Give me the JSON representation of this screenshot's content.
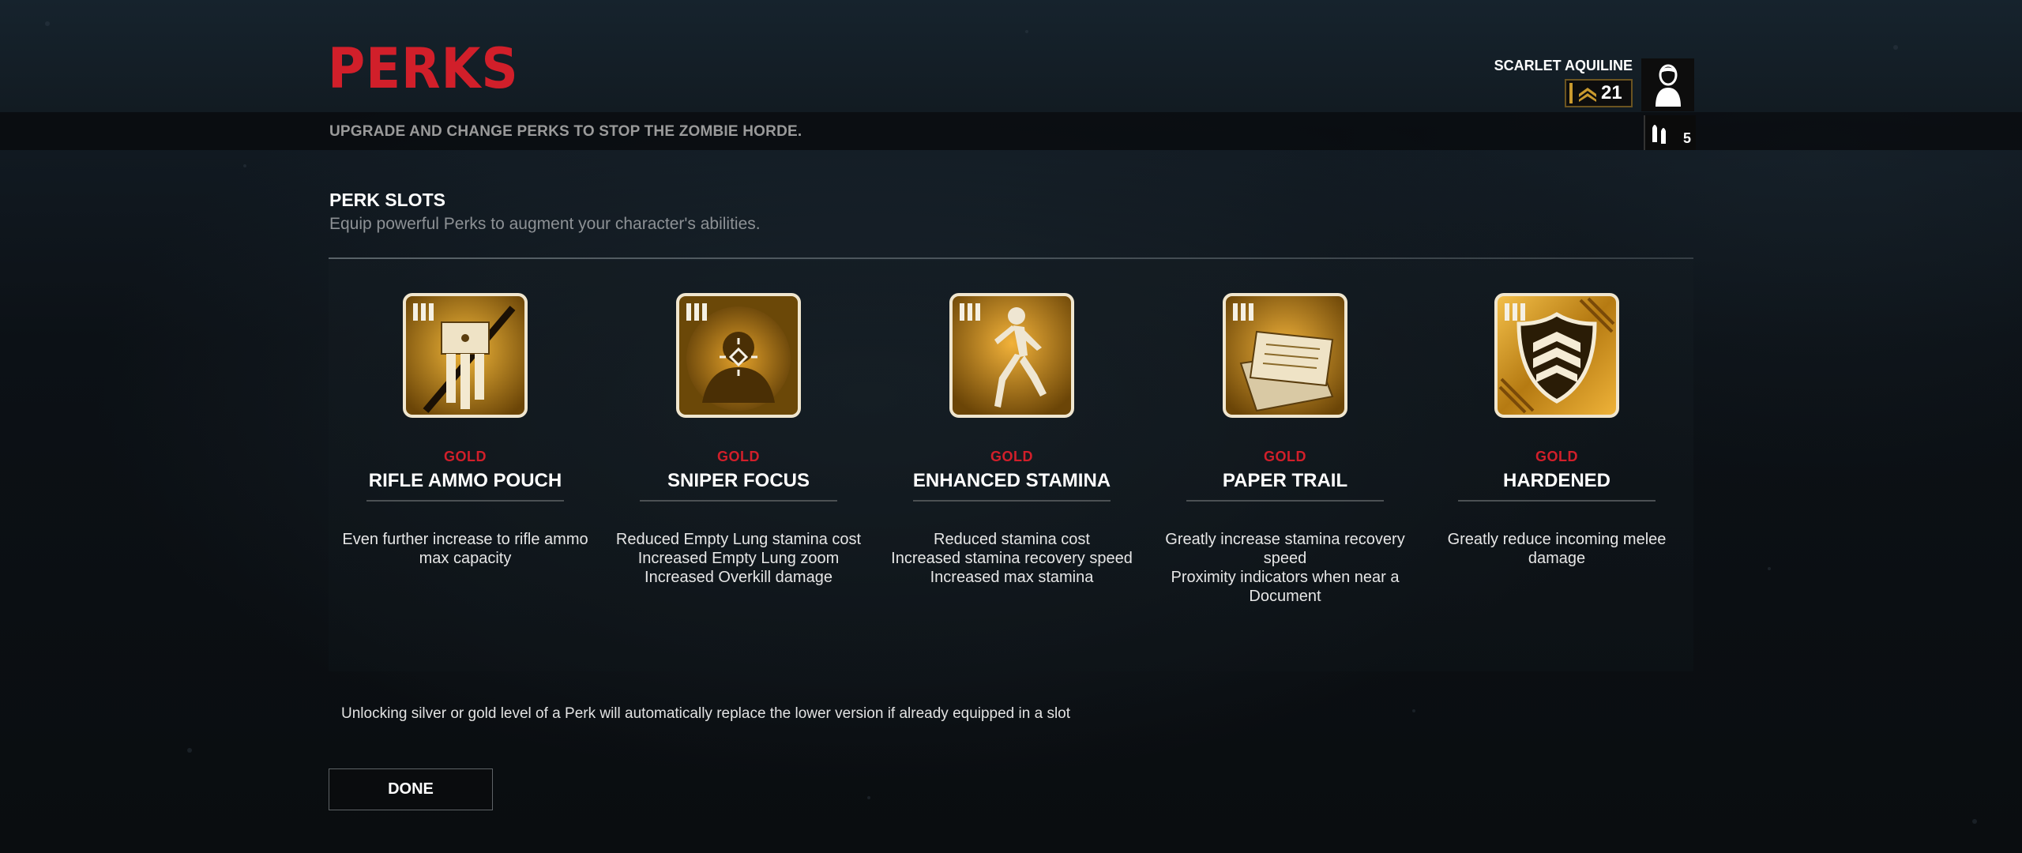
{
  "header": {
    "title": "PERKS",
    "subtitle": "UPGRADE AND CHANGE PERKS TO STOP THE ZOMBIE HORDE."
  },
  "player": {
    "name": "SCARLET AQUILINE",
    "level": "21",
    "bullet_count": "5",
    "rank_icon": "chevron-rank-icon",
    "avatar_icon": "player-silhouette-icon",
    "bullet_icon": "bullet-icon"
  },
  "section": {
    "title": "PERK SLOTS",
    "description": "Equip powerful Perks to augment your character's abilities."
  },
  "perks": [
    {
      "tier": "GOLD",
      "name": "RIFLE AMMO POUCH",
      "icon": "rifle-ammo-pouch-icon",
      "description": [
        "Even further increase to rifle ammo max capacity"
      ]
    },
    {
      "tier": "GOLD",
      "name": "SNIPER FOCUS",
      "icon": "sniper-focus-icon",
      "description": [
        "Reduced Empty Lung stamina cost",
        "Increased Empty Lung zoom",
        "Increased Overkill damage"
      ]
    },
    {
      "tier": "GOLD",
      "name": "ENHANCED STAMINA",
      "icon": "running-man-icon",
      "description": [
        "Reduced stamina cost",
        "Increased stamina recovery speed",
        "Increased max stamina"
      ]
    },
    {
      "tier": "GOLD",
      "name": "PAPER TRAIL",
      "icon": "documents-icon",
      "description": [
        "Greatly increase stamina recovery speed",
        "Proximity indicators when near a Document"
      ]
    },
    {
      "tier": "GOLD",
      "name": "HARDENED",
      "icon": "shield-chevron-icon",
      "description": [
        "Greatly reduce incoming melee damage"
      ]
    }
  ],
  "footnote": "Unlocking silver or gold level of a Perk will automatically replace the lower version if already equipped in a slot",
  "buttons": {
    "done": "DONE"
  },
  "colors": {
    "accent_red": "#d11f2a",
    "gold": "#c99a2e",
    "background": "#0b0e11"
  }
}
